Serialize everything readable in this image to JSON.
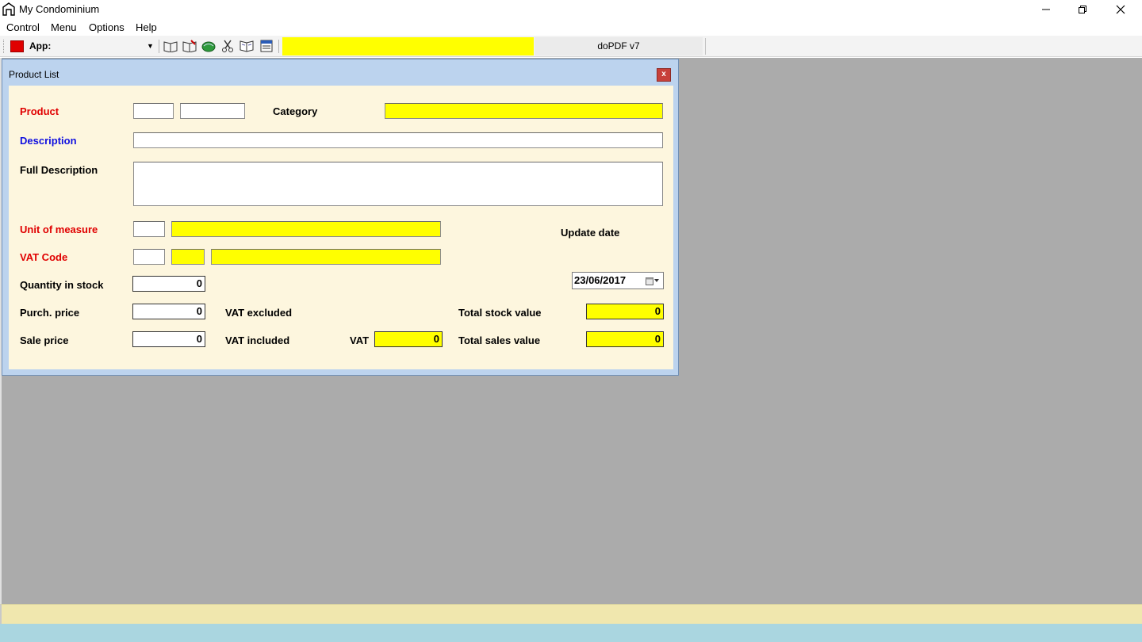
{
  "window": {
    "title": "My Condominium"
  },
  "menu": [
    "Control",
    "Menu",
    "Options",
    "Help"
  ],
  "toolbar": {
    "app_label": "App:",
    "printer_label": "doPDF v7"
  },
  "dialog": {
    "title": "Product List",
    "close_label": "x",
    "labels": {
      "product": "Product",
      "category": "Category",
      "description": "Description",
      "full_description": "Full Description",
      "unit_of_measure": "Unit of measure",
      "vat_code": "VAT Code",
      "quantity_in_stock": "Quantity in stock",
      "purch_price": "Purch. price",
      "sale_price": "Sale price",
      "vat_excluded": "VAT excluded",
      "vat_included": "VAT included",
      "vat": "VAT",
      "total_stock_value": "Total stock value",
      "total_sales_value": "Total sales value",
      "update_date": "Update date"
    },
    "values": {
      "quantity_in_stock": "0",
      "purch_price": "0",
      "sale_price": "0",
      "vat": "0",
      "total_stock_value": "0",
      "total_sales_value": "0",
      "update_date": "23/06/2017"
    }
  },
  "colors": {
    "highlight_yellow": "#ffff00",
    "form_background": "#fdf6de",
    "required_red": "#e00000",
    "link_blue": "#1010e0",
    "workspace_gray": "#ababab"
  }
}
